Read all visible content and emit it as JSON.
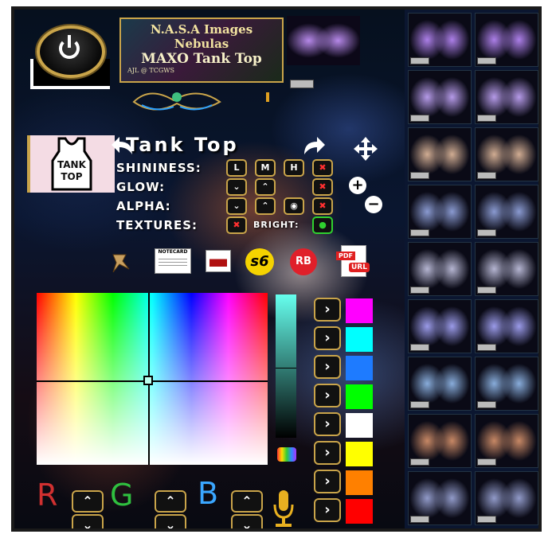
{
  "plaque": {
    "line1": "N.A.S.A Images",
    "line2": "Nebulas",
    "line3": "MAXO Tank Top",
    "line4": "AJL @ TCGWS"
  },
  "tank_icon": {
    "label_line1": "TANK",
    "label_line2": "TOP"
  },
  "header": {
    "title": "Tank Top",
    "undo_icon": "undo-arrow-icon",
    "redo_icon": "redo-arrow-icon",
    "move_icon": "move-arrows-icon"
  },
  "controls": {
    "shininess": {
      "label": "SHININESS:",
      "buttons": [
        "L",
        "M",
        "H",
        "✖"
      ]
    },
    "glow": {
      "label": "GLOW:",
      "buttons": [
        "⌄",
        "⌃",
        "✖"
      ]
    },
    "alpha": {
      "label": "ALPHA:",
      "buttons": [
        "⌄",
        "⌃",
        "◉",
        "✖"
      ]
    },
    "textures": {
      "label": "TEXTURES:",
      "button": "✖",
      "bright_label": "BRIGHT:",
      "bright_button": "●"
    },
    "plus": "+",
    "minus": "−"
  },
  "tools": {
    "notecard_label": "NOTECARD",
    "s6_label": "s6",
    "rb_label": "RB",
    "pdf_label": "PDF",
    "url_label": "URL"
  },
  "rgb": {
    "r": "R",
    "g": "G",
    "b": "B",
    "up": "⌃",
    "down": "⌄"
  },
  "arrow_label": "›",
  "swatches": [
    "#ff00ff",
    "#00ffff",
    "#1e7bff",
    "#00ff00",
    "#ffffff",
    "#ffff00",
    "#ff8000",
    "#ff0000"
  ],
  "colors": {
    "accent_gold": "#c9a44a",
    "panel": "#050914"
  }
}
